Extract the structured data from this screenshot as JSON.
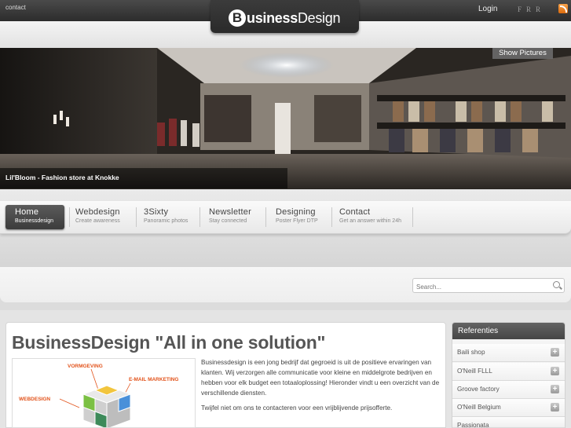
{
  "topbar": {
    "contact": "contact",
    "login": "Login",
    "languages": [
      "F",
      "R",
      "R"
    ]
  },
  "logo": {
    "mark": "B",
    "bold": "usiness",
    "regular": "Design"
  },
  "hero": {
    "show_pictures": "Show Pictures",
    "caption": "Lil'Bloom - Fashion store at Knokke"
  },
  "nav": [
    {
      "title": "Home",
      "subtitle": "Businessdesign",
      "active": true
    },
    {
      "title": "Webdesign",
      "subtitle": "Create awareness"
    },
    {
      "title": "3Sixty",
      "subtitle": "Panoramic photos"
    },
    {
      "title": "Newsletter",
      "subtitle": "Stay connected"
    },
    {
      "title": "Designing",
      "subtitle": "Poster Flyer DTP"
    },
    {
      "title": "Contact",
      "subtitle": "Get an answer within 24h"
    }
  ],
  "search": {
    "placeholder": "Search..."
  },
  "main": {
    "title": "BusinessDesign \"All in one solution\"",
    "paragraph1": "Businessdesign is een jong bedrijf dat gegroeid is uit de positieve ervaringen van klanten. Wij verzorgen alle communicatie voor kleine en middelgrote bedrijven en hebben voor elk budget een totaaloplossing! Hieronder vindt u een overzicht van de verschillende diensten.",
    "paragraph2": "Twijfel niet om ons te contacteren voor een vrijblijvende prijsofferte.",
    "image_labels": {
      "vormgeving": "VORMGEVING",
      "email": "E-MAIL MARKETING",
      "webdesign": "WEBDESIGN"
    }
  },
  "sidebar": {
    "title": "Referenties",
    "items": [
      {
        "label": "Baili shop"
      },
      {
        "label": "O'Neill FLLL"
      },
      {
        "label": "Groove factory"
      },
      {
        "label": "O'Neill Belgium"
      },
      {
        "label": "Passionata"
      }
    ]
  },
  "colors": {
    "topbar": "#2c2c2c",
    "rss": "#ef8a22",
    "image_label_orange": "#e2531b",
    "nav_active": "#444444"
  }
}
